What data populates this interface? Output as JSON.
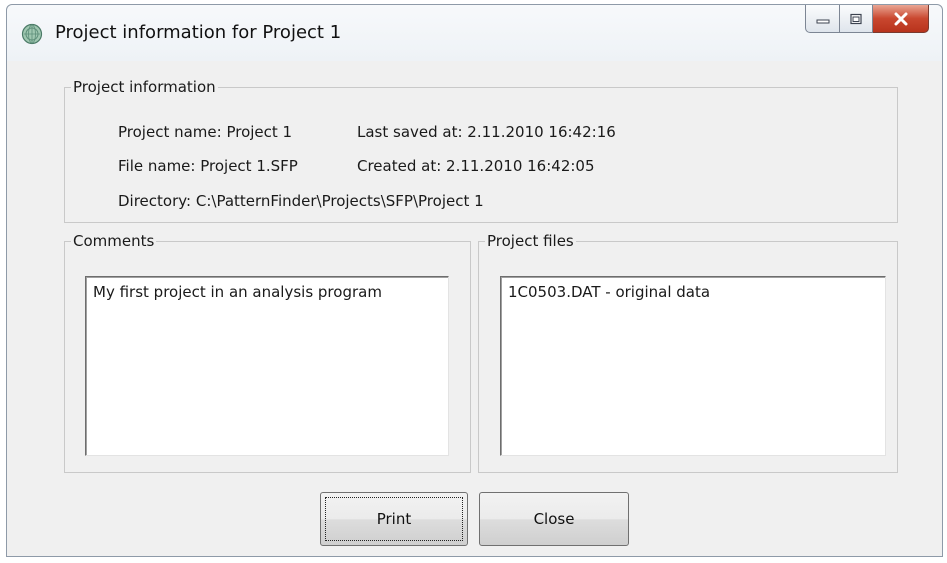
{
  "window": {
    "title": "Project information for Project 1",
    "app_icon": "globe-icon",
    "caption_icons": [
      "minimize-icon",
      "maximize-icon",
      "close-icon"
    ]
  },
  "project_info": {
    "group_label": "Project information",
    "project_name": "Project name: Project 1",
    "last_saved": "Last saved at: 2.11.2010 16:42:16",
    "file_name": "File name: Project 1.SFP",
    "created": "Created at: 2.11.2010 16:42:05",
    "directory": "Directory: C:\\PatternFinder\\Projects\\SFP\\Project 1"
  },
  "comments": {
    "group_label": "Comments",
    "text": "My first project in an analysis program"
  },
  "project_files": {
    "group_label": "Project files",
    "items": [
      "1C0503.DAT - original data"
    ]
  },
  "buttons": {
    "print_label": "Print",
    "close_label": "Close"
  },
  "colors": {
    "close_button": "#c9472f",
    "window_bg": "#f0f0f0"
  }
}
